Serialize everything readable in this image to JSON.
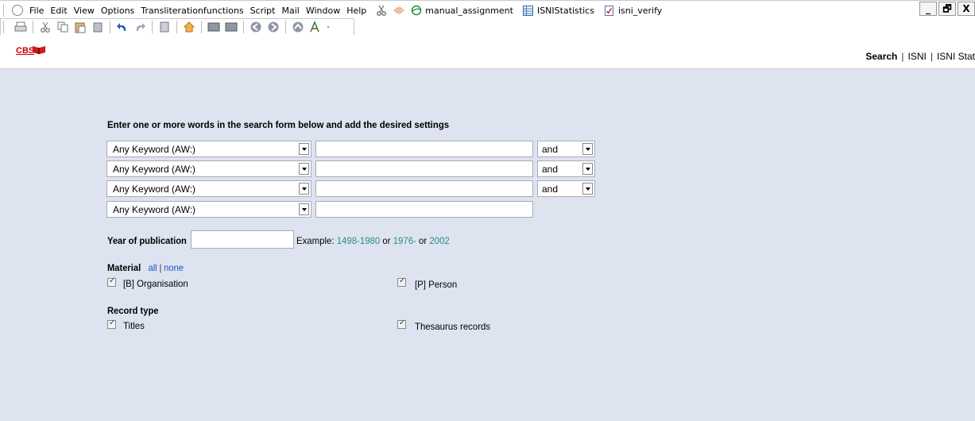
{
  "menubar": {
    "items": [
      "File",
      "Edit",
      "View",
      "Options",
      "Transliterationfunctions",
      "Script",
      "Mail",
      "Window",
      "Help"
    ],
    "bookmarks": [
      {
        "label": "manual_assignment",
        "icon": "ie-globe-icon"
      },
      {
        "label": "ISNIStatistics",
        "icon": "table-icon"
      },
      {
        "label": "isni_verify",
        "icon": "document-check-icon"
      }
    ],
    "window_controls": [
      "_",
      "🗗",
      "X"
    ]
  },
  "header": {
    "logo_text": "CBS",
    "nav": [
      "Search",
      "ISNI",
      "ISNI Stat"
    ]
  },
  "form": {
    "intro": "Enter one or more words in the search form below and add the desired settings",
    "rows": [
      {
        "field": "Any Keyword (AW:)",
        "value": "",
        "operator": "and"
      },
      {
        "field": "Any Keyword (AW:)",
        "value": "",
        "operator": "and"
      },
      {
        "field": "Any Keyword (AW:)",
        "value": "",
        "operator": "and"
      },
      {
        "field": "Any Keyword (AW:)",
        "value": ""
      }
    ],
    "year_label": "Year of publication",
    "year_value": "",
    "example_prefix": "Example: ",
    "example_1": "1498-1980",
    "example_or1": " or ",
    "example_2": "1976-",
    "example_or2": " or ",
    "example_3": "2002",
    "material_label": "Material",
    "material_all": "all",
    "material_sep": "|",
    "material_none": "none",
    "material_options": [
      {
        "label": "[B] Organisation",
        "checked": true
      },
      {
        "label": "[P] Person",
        "checked": true
      }
    ],
    "record_type_label": "Record type",
    "record_type_options": [
      {
        "label": "Titles",
        "checked": true
      },
      {
        "label": "Thesaurus records",
        "checked": true
      }
    ]
  },
  "colors": {
    "page_bg": "#dde4ef",
    "link_teal": "#2a8a8a",
    "link_blue": "#1f4fcc"
  }
}
